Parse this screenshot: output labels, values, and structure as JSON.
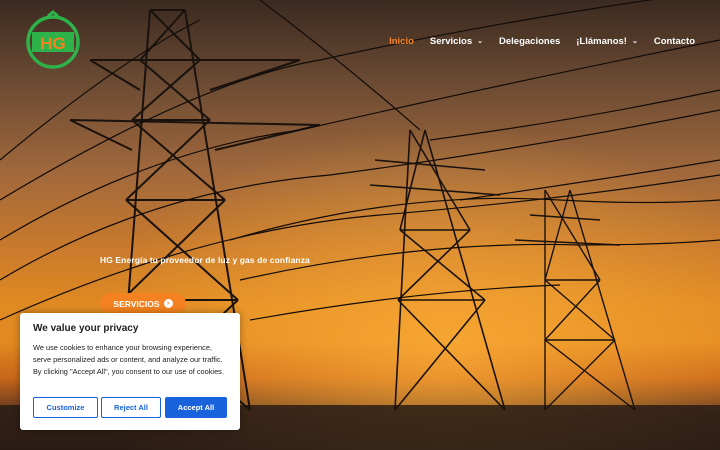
{
  "logo": {
    "text": "HG",
    "icon": "hg-energia-logo"
  },
  "nav": {
    "items": [
      {
        "label": "Inicio",
        "active": true,
        "dropdown": false
      },
      {
        "label": "Servicios",
        "active": false,
        "dropdown": true
      },
      {
        "label": "Delegaciones",
        "active": false,
        "dropdown": false
      },
      {
        "label": "¡Llámanos!",
        "active": false,
        "dropdown": true
      },
      {
        "label": "Contacto",
        "active": false,
        "dropdown": false
      }
    ]
  },
  "hero": {
    "tagline": "HG Energía tu proveedor de luz y gas de confianza",
    "button_label": "SERVICIOS",
    "button_icon": "arrow-right-circle-icon"
  },
  "cookie_banner": {
    "title": "We value your privacy",
    "text": "We use cookies to enhance your browsing experience, serve personalized ads or content, and analyze our traffic. By clicking \"Accept All\", you consent to our use of cookies.",
    "customize_label": "Customize",
    "reject_label": "Reject All",
    "accept_label": "Accept All"
  },
  "colors": {
    "accent": "#f58220",
    "primary_button": "#1863dc",
    "logo_green": "#2db34a"
  }
}
